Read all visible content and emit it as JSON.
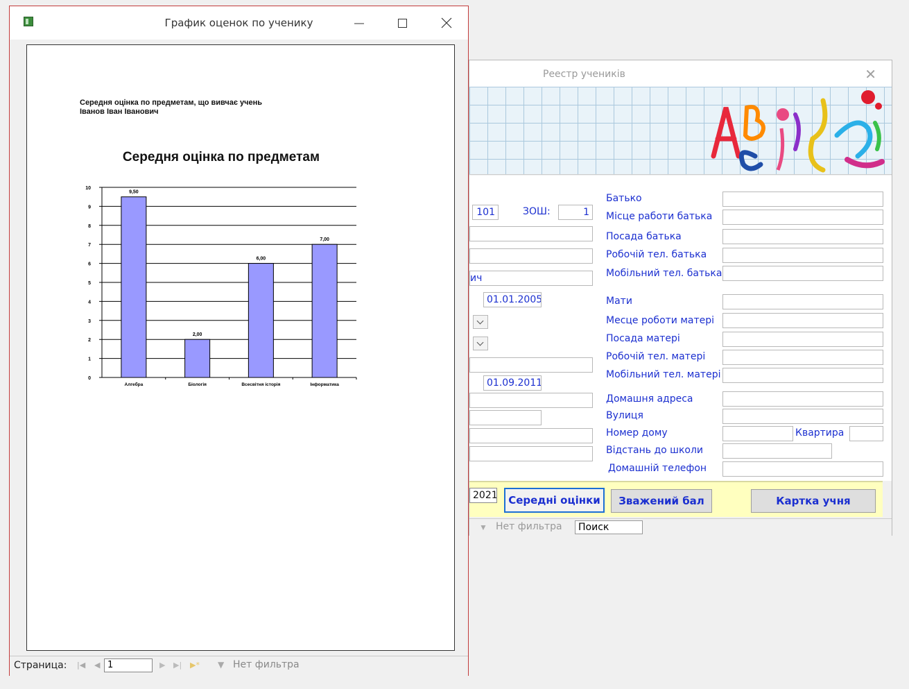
{
  "back_window": {
    "title": "Реестр учеників",
    "labels": {
      "zosh": "ЗОШ:",
      "father": "Батько",
      "father_work": "Місце работи батька",
      "father_position": "Посада батька",
      "father_work_phone": "Робочій тел. батька",
      "father_mobile": "Мобільний тел. батька",
      "mother": "Мати",
      "mother_work": "Месце роботи матері",
      "mother_position": "Посада матері",
      "mother_work_phone": "Робочій тел. матері",
      "mother_mobile": "Мобільний тел. матері",
      "home_address": "Домашня адреса",
      "street": "Вулиця",
      "house_number": "Номер дому",
      "apartment": "Квартира",
      "distance": "Відстань до школи",
      "home_phone": "Домашній телефон"
    },
    "values": {
      "class_num": "101",
      "zosh": "1",
      "patronymic_partial": "ич",
      "birth_date": "01.01.2005",
      "enroll_date": "01.09.2011",
      "year_partial": "2021"
    },
    "buttons": {
      "avg_grades": "Середні оцінки",
      "weighted": "Зважений бал",
      "student_card": "Картка учня"
    },
    "nav": {
      "filter": "Нет фильтра",
      "search": "Поиск"
    }
  },
  "front_window": {
    "title": "График оценок по ученику",
    "report_line1": "Середня оцінка по предметам, що вивчає учень",
    "report_line2": "Іванов Іван Іванович",
    "status": {
      "page_label": "Страница:",
      "page_value": "1",
      "filter": "Нет фильтра"
    }
  },
  "colors": {
    "bar": "#9999ff",
    "label_blue": "#1b2fd0",
    "window_border": "#c23a3a"
  },
  "chart_data": {
    "type": "bar",
    "title": "Середня оцінка по предметам",
    "categories": [
      "Алгебра",
      "Біологія",
      "Всесвітня історія",
      "Інформатика"
    ],
    "values": [
      9.5,
      2.0,
      6.0,
      7.0
    ],
    "value_labels": [
      "9,50",
      "2,00",
      "6,00",
      "7,00"
    ],
    "ylim": [
      0,
      10
    ],
    "yticks": [
      0,
      1,
      2,
      3,
      4,
      5,
      6,
      7,
      8,
      9,
      10
    ],
    "grid": true,
    "xlabel": "",
    "ylabel": ""
  }
}
